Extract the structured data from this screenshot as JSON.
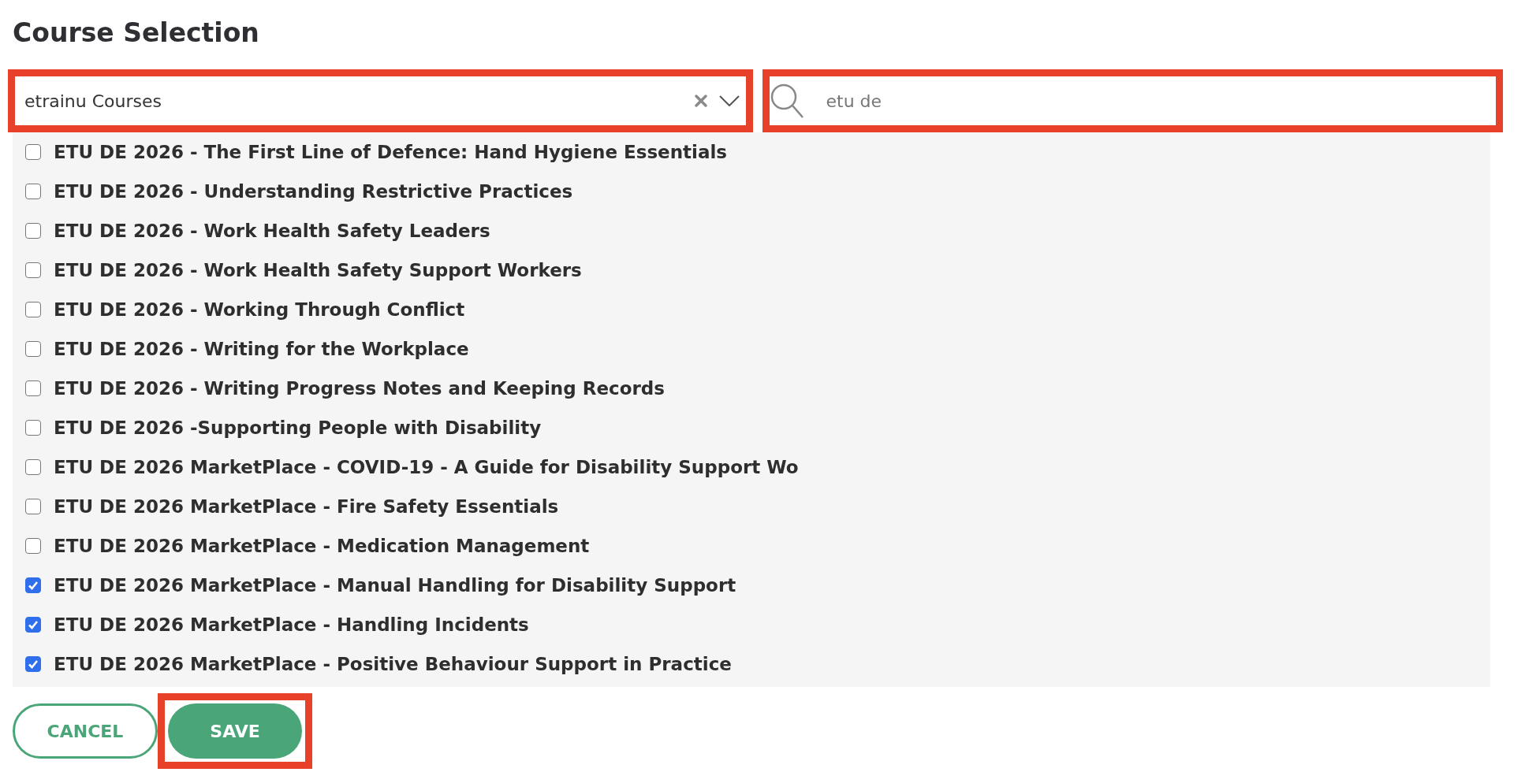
{
  "title": "Course Selection",
  "category_select": {
    "value": "etrainu Courses",
    "highlighted": true
  },
  "search": {
    "value": "etu de",
    "highlighted": true
  },
  "courses": [
    {
      "label": "ETU DE 2026 - The First Line of Defence: Hand Hygiene Essentials",
      "checked": false
    },
    {
      "label": "ETU DE 2026 - Understanding Restrictive Practices",
      "checked": false
    },
    {
      "label": "ETU DE 2026 - Work Health Safety Leaders",
      "checked": false
    },
    {
      "label": "ETU DE 2026 - Work Health Safety Support Workers",
      "checked": false
    },
    {
      "label": "ETU DE 2026 - Working Through Conflict",
      "checked": false
    },
    {
      "label": "ETU DE 2026 - Writing for the Workplace",
      "checked": false
    },
    {
      "label": "ETU DE 2026 - Writing Progress Notes and Keeping Records",
      "checked": false
    },
    {
      "label": "ETU DE 2026 -Supporting People with Disability",
      "checked": false
    },
    {
      "label": "ETU DE 2026 MarketPlace - COVID-19 - A Guide for Disability Support Wo",
      "checked": false
    },
    {
      "label": "ETU DE 2026 MarketPlace - Fire Safety Essentials",
      "checked": false
    },
    {
      "label": "ETU DE 2026 MarketPlace - Medication Management",
      "checked": false
    },
    {
      "label": "ETU DE 2026 MarketPlace - Manual Handling for Disability Support",
      "checked": true
    },
    {
      "label": "ETU DE 2026 MarketPlace - Handling Incidents",
      "checked": true
    },
    {
      "label": "ETU DE 2026 MarketPlace - Positive Behaviour Support in Practice",
      "checked": true
    }
  ],
  "buttons": [
    {
      "kind": "outline",
      "label": "CANCEL",
      "highlighted": false
    },
    {
      "kind": "filled",
      "label": "SAVE",
      "highlighted": true
    }
  ]
}
